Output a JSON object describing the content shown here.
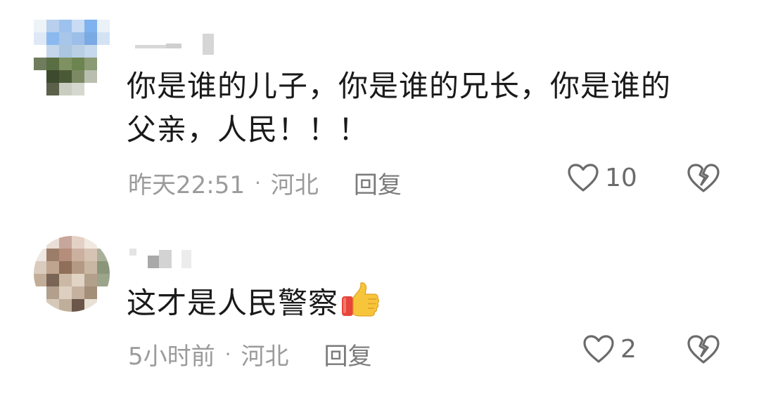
{
  "comments": [
    {
      "text_lines": [
        "你是谁的儿子，你是谁的兄长，你是谁的",
        "父亲，人民！！！"
      ],
      "time": "昨天22:51",
      "separator": "·",
      "location": "河北",
      "reply_label": "回复",
      "like_count": "10"
    },
    {
      "text_lines": [
        "这才是人民警察"
      ],
      "time": "5小时前",
      "separator": "·",
      "location": "河北",
      "reply_label": "回复",
      "like_count": "2"
    }
  ],
  "icons": {
    "like": "heart-outline-icon",
    "dislike": "broken-heart-icon",
    "emoji": "thumbs-up-emoji"
  },
  "colors": {
    "text": "#1a1a1a",
    "meta": "#9b9b9b",
    "icon": "#6b6b6b",
    "thumb_yellow": "#f7c53b",
    "thumb_red": "#e8453c"
  }
}
